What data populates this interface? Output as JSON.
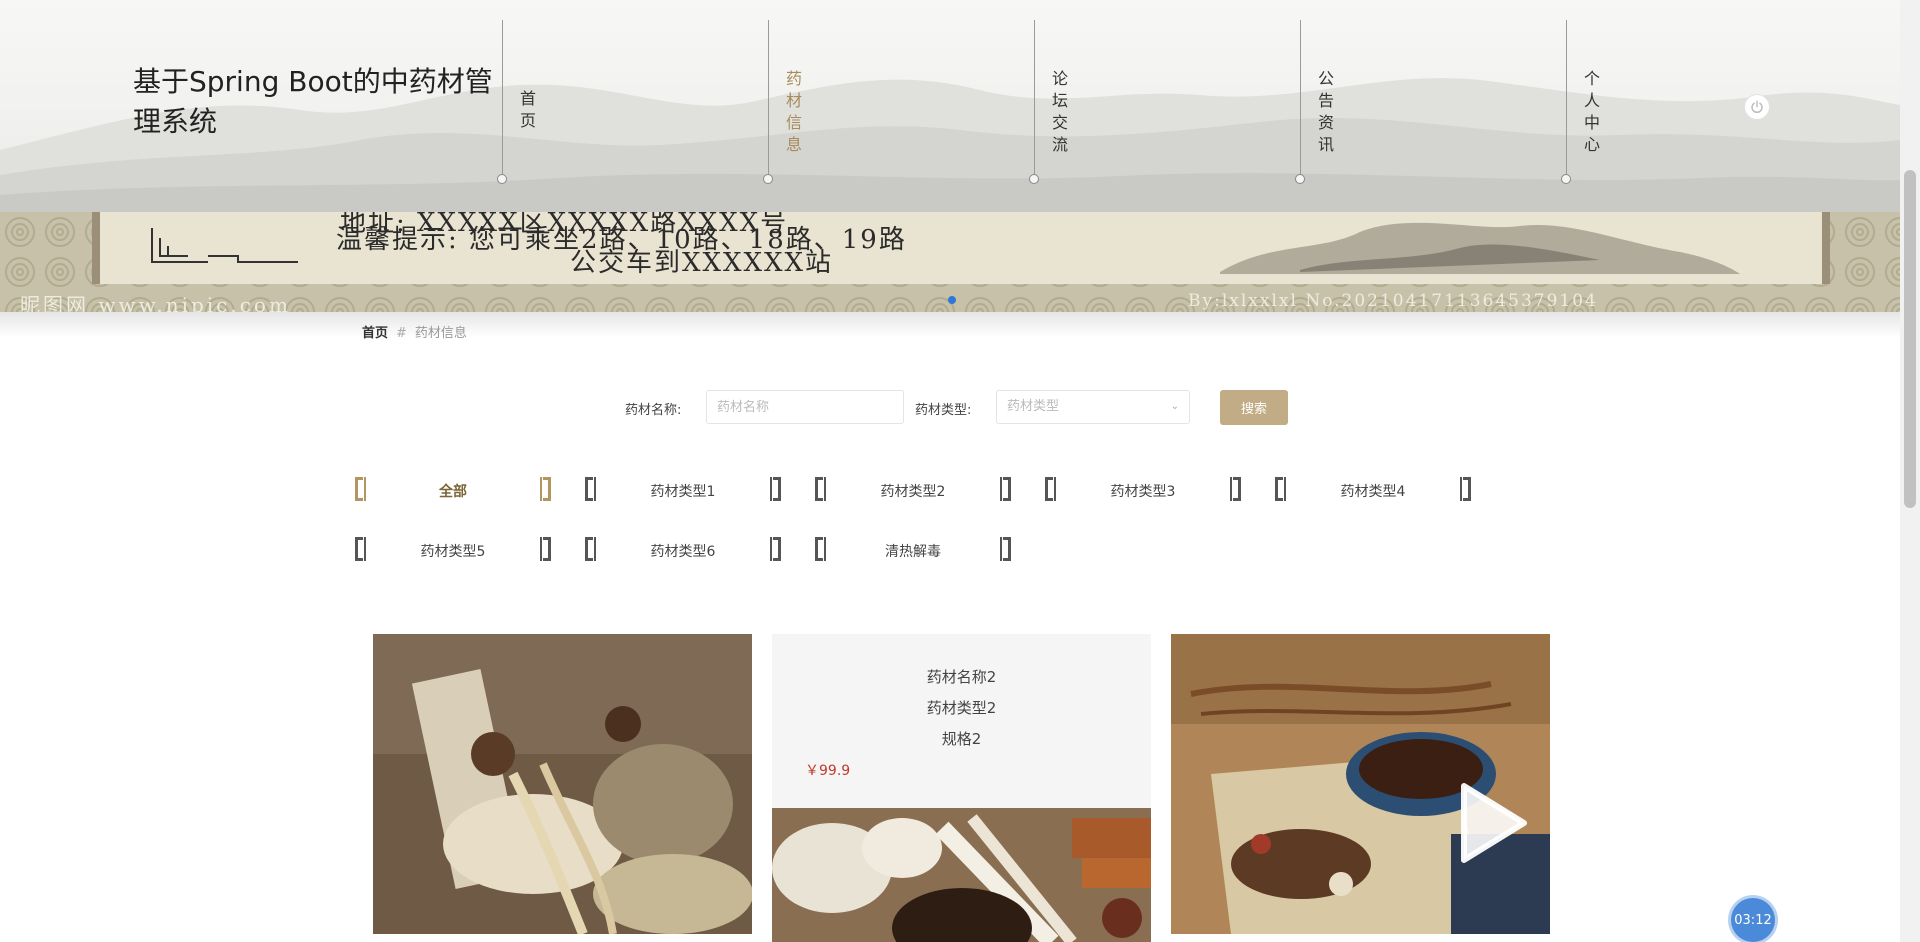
{
  "site": {
    "title": "基于Spring Boot的中药材管理系统"
  },
  "nav": {
    "items": [
      {
        "label": "首页",
        "active": false
      },
      {
        "label": "药材信息",
        "active": true
      },
      {
        "label": "论坛交流",
        "active": false
      },
      {
        "label": "公告资讯",
        "active": false
      },
      {
        "label": "个人中心",
        "active": false
      }
    ],
    "logout_icon": "power-icon"
  },
  "banner": {
    "line1": "地址: XXXXX区XXXXX路XXXX号",
    "line2": "温馨提示: 您可乘坐2路、10路、18路、19路",
    "line3": "公交车到XXXXXX站",
    "footer_left": "昵图网 www.nipic.com",
    "footer_right": "By:lxlxxlxl No.20210417113645379104"
  },
  "breadcrumb": {
    "home": "首页",
    "separator": "#",
    "current": "药材信息"
  },
  "search": {
    "name_label": "药材名称:",
    "name_placeholder": "药材名称",
    "type_label": "药材类型:",
    "type_placeholder": "药材类型",
    "button_label": "搜索"
  },
  "categories": [
    {
      "label": "全部",
      "active": true
    },
    {
      "label": "药材类型1",
      "active": false
    },
    {
      "label": "药材类型2",
      "active": false
    },
    {
      "label": "药材类型3",
      "active": false
    },
    {
      "label": "药材类型4",
      "active": false
    },
    {
      "label": "药材类型5",
      "active": false
    },
    {
      "label": "药材类型6",
      "active": false
    },
    {
      "label": "清热解毒",
      "active": false
    }
  ],
  "products": {
    "info_card": {
      "name": "药材名称2",
      "type": "药材类型2",
      "spec": "规格2",
      "price": "￥99.9"
    }
  },
  "timer": "03:12",
  "colors": {
    "accent": "#c2ac85",
    "active_nav": "#a88c5a",
    "price": "#c0392b",
    "timer": "#4a8ad8"
  }
}
